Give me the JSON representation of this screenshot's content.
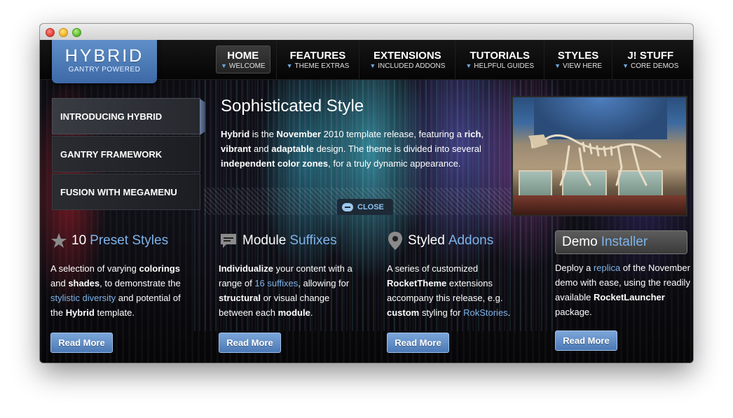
{
  "window": {
    "controls": [
      "close",
      "minimize",
      "zoom"
    ]
  },
  "logo": {
    "word": "HYBRID",
    "sub": "GANTRY POWERED"
  },
  "nav": [
    {
      "label": "HOME",
      "sub": "WELCOME",
      "active": true
    },
    {
      "label": "FEATURES",
      "sub": "THEME EXTRAS"
    },
    {
      "label": "EXTENSIONS",
      "sub": "INCLUDED ADDONS"
    },
    {
      "label": "TUTORIALS",
      "sub": "HELPFUL GUIDES"
    },
    {
      "label": "STYLES",
      "sub": "VIEW HERE"
    },
    {
      "label": "J! STUFF",
      "sub": "CORE DEMOS"
    }
  ],
  "showcase": {
    "tabs": [
      "INTRODUCING HYBRID",
      "GANTRY FRAMEWORK",
      "FUSION WITH MEGAMENU"
    ],
    "title": "Sophisticated Style",
    "text_parts": [
      {
        "t": "Hybrid",
        "b": true
      },
      {
        "t": " is the ",
        "b": false
      },
      {
        "t": "November",
        "b": true
      },
      {
        "t": " 2010 template release, featuring a ",
        "b": false
      },
      {
        "t": "rich",
        "b": true
      },
      {
        "t": ", ",
        "b": false
      },
      {
        "t": "vibrant",
        "b": true
      },
      {
        "t": " and ",
        "b": false
      },
      {
        "t": "adaptable",
        "b": true
      },
      {
        "t": " design. The theme is divided into several ",
        "b": false
      },
      {
        "t": "independent color zones",
        "b": true
      },
      {
        "t": ", for a truly dynamic appearance.",
        "b": false
      }
    ],
    "close_label": "CLOSE"
  },
  "modules": [
    {
      "icon": "star-icon",
      "title_a": "10",
      "title_b": "Preset Styles",
      "body": [
        {
          "t": "A selection of varying ",
          "s": ""
        },
        {
          "t": "colorings",
          "s": "b"
        },
        {
          "t": " and ",
          "s": ""
        },
        {
          "t": "shades",
          "s": "b"
        },
        {
          "t": ", to demonstrate the ",
          "s": ""
        },
        {
          "t": "stylistic diversity",
          "s": "lnk"
        },
        {
          "t": " and potential of the ",
          "s": ""
        },
        {
          "t": "Hybrid",
          "s": "b"
        },
        {
          "t": " template.",
          "s": ""
        }
      ],
      "button": "Read More"
    },
    {
      "icon": "speech-bubble-icon",
      "title_a": "Module",
      "title_b": "Suffixes",
      "body": [
        {
          "t": "Individualize",
          "s": "b"
        },
        {
          "t": " your content with a range of ",
          "s": ""
        },
        {
          "t": "16 suffixes",
          "s": "lnk"
        },
        {
          "t": ", allowing for ",
          "s": ""
        },
        {
          "t": "structural",
          "s": "b"
        },
        {
          "t": " or visual change between each ",
          "s": ""
        },
        {
          "t": "module",
          "s": "b"
        },
        {
          "t": ".",
          "s": ""
        }
      ],
      "button": "Read More"
    },
    {
      "icon": "map-pin-icon",
      "title_a": "Styled",
      "title_b": "Addons",
      "body": [
        {
          "t": "A series of customized ",
          "s": ""
        },
        {
          "t": "RocketTheme",
          "s": "b"
        },
        {
          "t": " extensions accompany this release, e.g. ",
          "s": ""
        },
        {
          "t": "custom",
          "s": "b"
        },
        {
          "t": " styling for ",
          "s": ""
        },
        {
          "t": "RokStories",
          "s": "lnk"
        },
        {
          "t": ".",
          "s": ""
        }
      ],
      "button": "Read More"
    },
    {
      "icon": "",
      "title_a": "Demo",
      "title_b": "Installer",
      "body": [
        {
          "t": "Deploy a ",
          "s": ""
        },
        {
          "t": "replica",
          "s": "lnk"
        },
        {
          "t": " of the November demo with ease, using the readily available ",
          "s": ""
        },
        {
          "t": "RocketLauncher",
          "s": "b"
        },
        {
          "t": " package.",
          "s": ""
        }
      ],
      "button": "Read More"
    }
  ],
  "colors": {
    "accent": "#7eb3ea",
    "logo_bg": "#4b79b5",
    "button_bg": "#5b88c2"
  }
}
